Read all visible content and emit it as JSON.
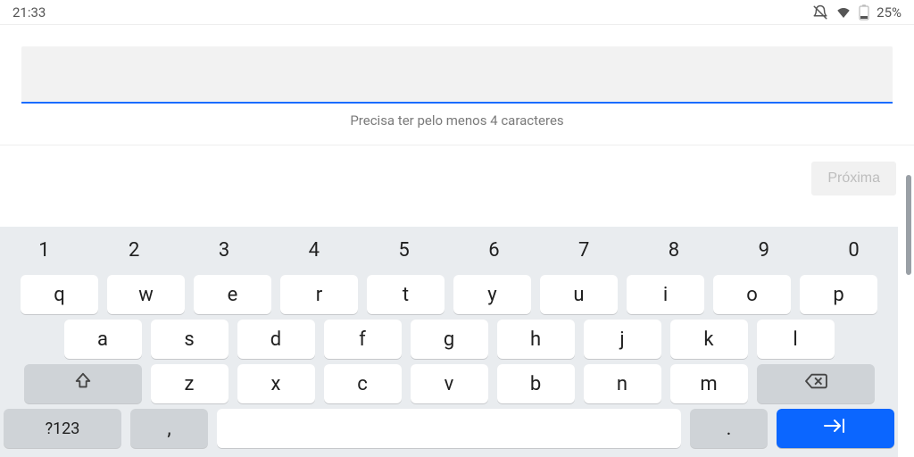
{
  "status": {
    "time": "21:33",
    "battery_percent": "25%"
  },
  "form": {
    "input_value": "",
    "helper_text": "Precisa ter pelo menos 4 caracteres",
    "next_label": "Próxima"
  },
  "keyboard": {
    "row_numbers": [
      "1",
      "2",
      "3",
      "4",
      "5",
      "6",
      "7",
      "8",
      "9",
      "0"
    ],
    "row_q": [
      "q",
      "w",
      "e",
      "r",
      "t",
      "y",
      "u",
      "i",
      "o",
      "p"
    ],
    "row_a": [
      "a",
      "s",
      "d",
      "f",
      "g",
      "h",
      "j",
      "k",
      "l"
    ],
    "row_z": [
      "z",
      "x",
      "c",
      "v",
      "b",
      "n",
      "m"
    ],
    "symbols_label": "?123",
    "comma": ",",
    "period": "."
  }
}
